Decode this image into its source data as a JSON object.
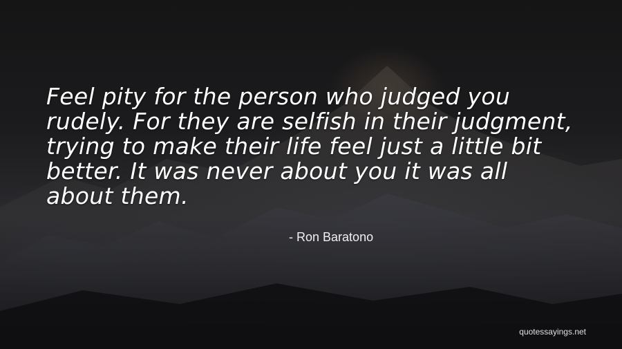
{
  "quote": {
    "lines": [
      "Feel pity for the person who judged you",
      "rudely. For they are selfish in their judgment,",
      "trying to make their life feel just a little bit",
      "better. It was never about you it was all",
      "about them."
    ]
  },
  "author": {
    "dash": "-",
    "name": "Ron Baratono"
  },
  "watermark": {
    "text": "quotessayings.net"
  },
  "colors": {
    "text": "#ffffff",
    "background": "#1b1b1d"
  }
}
